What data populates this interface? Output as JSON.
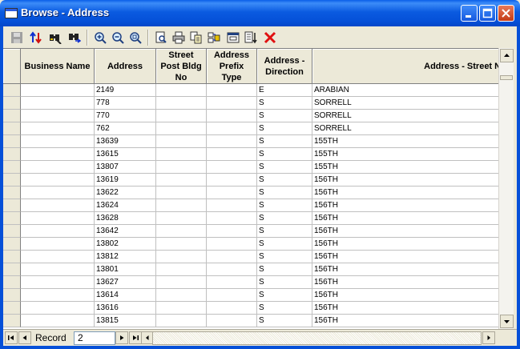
{
  "window": {
    "title": "Browse - Address"
  },
  "toolbar": {
    "buttons": [
      "save-icon",
      "sort-icon",
      "find-icon",
      "find-next-icon",
      "zoom-in-icon",
      "zoom-out-icon",
      "zoom-fit-icon",
      "print-preview-icon",
      "print-icon",
      "copy-icon",
      "export-icon",
      "properties-icon",
      "sort-list-icon",
      "delete-icon"
    ]
  },
  "columns": [
    "Business Name",
    "Address",
    "Street\nPost Bldg\nNo",
    "Address\nPrefix\nType",
    "Address -\nDirection",
    "Address - Street Nam"
  ],
  "rows": [
    [
      "",
      "2149",
      "",
      "",
      "E",
      "ARABIAN"
    ],
    [
      "",
      "778",
      "",
      "",
      "S",
      "SORRELL"
    ],
    [
      "",
      "770",
      "",
      "",
      "S",
      "SORRELL"
    ],
    [
      "",
      "762",
      "",
      "",
      "S",
      "SORRELL"
    ],
    [
      "",
      "13639",
      "",
      "",
      "S",
      "155TH"
    ],
    [
      "",
      "13615",
      "",
      "",
      "S",
      "155TH"
    ],
    [
      "",
      "13807",
      "",
      "",
      "S",
      "155TH"
    ],
    [
      "",
      "13619",
      "",
      "",
      "S",
      "156TH"
    ],
    [
      "",
      "13622",
      "",
      "",
      "S",
      "156TH"
    ],
    [
      "",
      "13624",
      "",
      "",
      "S",
      "156TH"
    ],
    [
      "",
      "13628",
      "",
      "",
      "S",
      "156TH"
    ],
    [
      "",
      "13642",
      "",
      "",
      "S",
      "156TH"
    ],
    [
      "",
      "13802",
      "",
      "",
      "S",
      "156TH"
    ],
    [
      "",
      "13812",
      "",
      "",
      "S",
      "156TH"
    ],
    [
      "",
      "13801",
      "",
      "",
      "S",
      "156TH"
    ],
    [
      "",
      "13627",
      "",
      "",
      "S",
      "156TH"
    ],
    [
      "",
      "13614",
      "",
      "",
      "S",
      "156TH"
    ],
    [
      "",
      "13616",
      "",
      "",
      "S",
      "156TH"
    ],
    [
      "",
      "13815",
      "",
      "",
      "S",
      "156TH"
    ]
  ],
  "navigator": {
    "record_label": "Record",
    "record_value": "2"
  }
}
